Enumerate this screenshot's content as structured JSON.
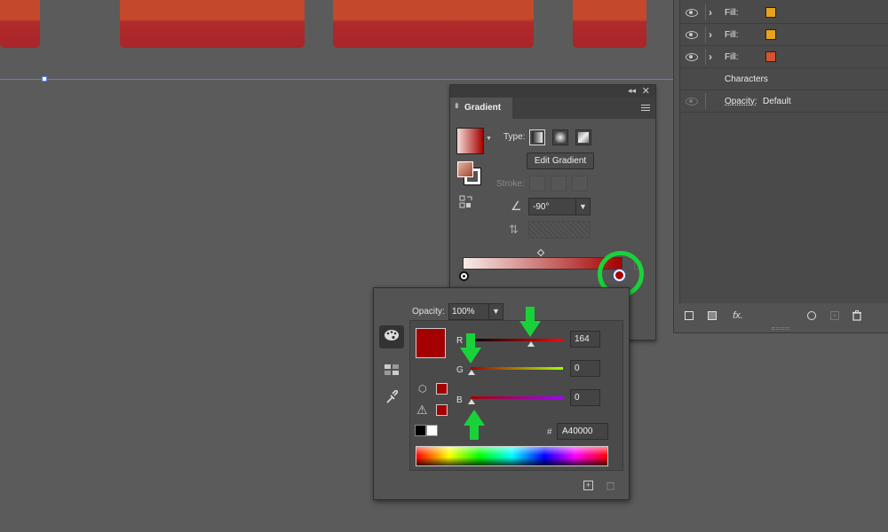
{
  "colors": {
    "accent_green": "#19d23a",
    "selected_red": "#a40000",
    "panel_bg": "#535353",
    "canvas_bg": "#5b5b5b"
  },
  "appearance": {
    "rows": [
      {
        "label": "Fill:",
        "swatch": "#e8a21e",
        "visible": true,
        "expandable": true
      },
      {
        "label": "Fill:",
        "swatch": "#e8a21e",
        "visible": true,
        "expandable": true
      },
      {
        "label": "Fill:",
        "swatch": "#d6532d",
        "visible": true,
        "expandable": true
      }
    ],
    "characters_label": "Characters",
    "opacity_label": "Opacity:",
    "opacity_value": "Default",
    "footer_icons": [
      "new-stroke-icon",
      "new-fill-icon",
      "fx-icon",
      "clear-icon",
      "duplicate-icon",
      "trash-icon"
    ]
  },
  "gradient": {
    "tab_title": "Gradient",
    "type_label": "Type:",
    "edit_button": "Edit Gradient",
    "stroke_label": "Stroke:",
    "angle_value": "-90°",
    "stops": [
      {
        "color": "#ffffff",
        "location_pct": 0
      },
      {
        "color": "#a40000",
        "location_pct": 100
      }
    ]
  },
  "picker": {
    "opacity_label": "Opacity:",
    "opacity_value": "100%",
    "channels": [
      {
        "label": "R",
        "value": "164"
      },
      {
        "label": "G",
        "value": "0"
      },
      {
        "label": "B",
        "value": "0"
      }
    ],
    "hex_label": "#",
    "hex_value": "A40000"
  }
}
